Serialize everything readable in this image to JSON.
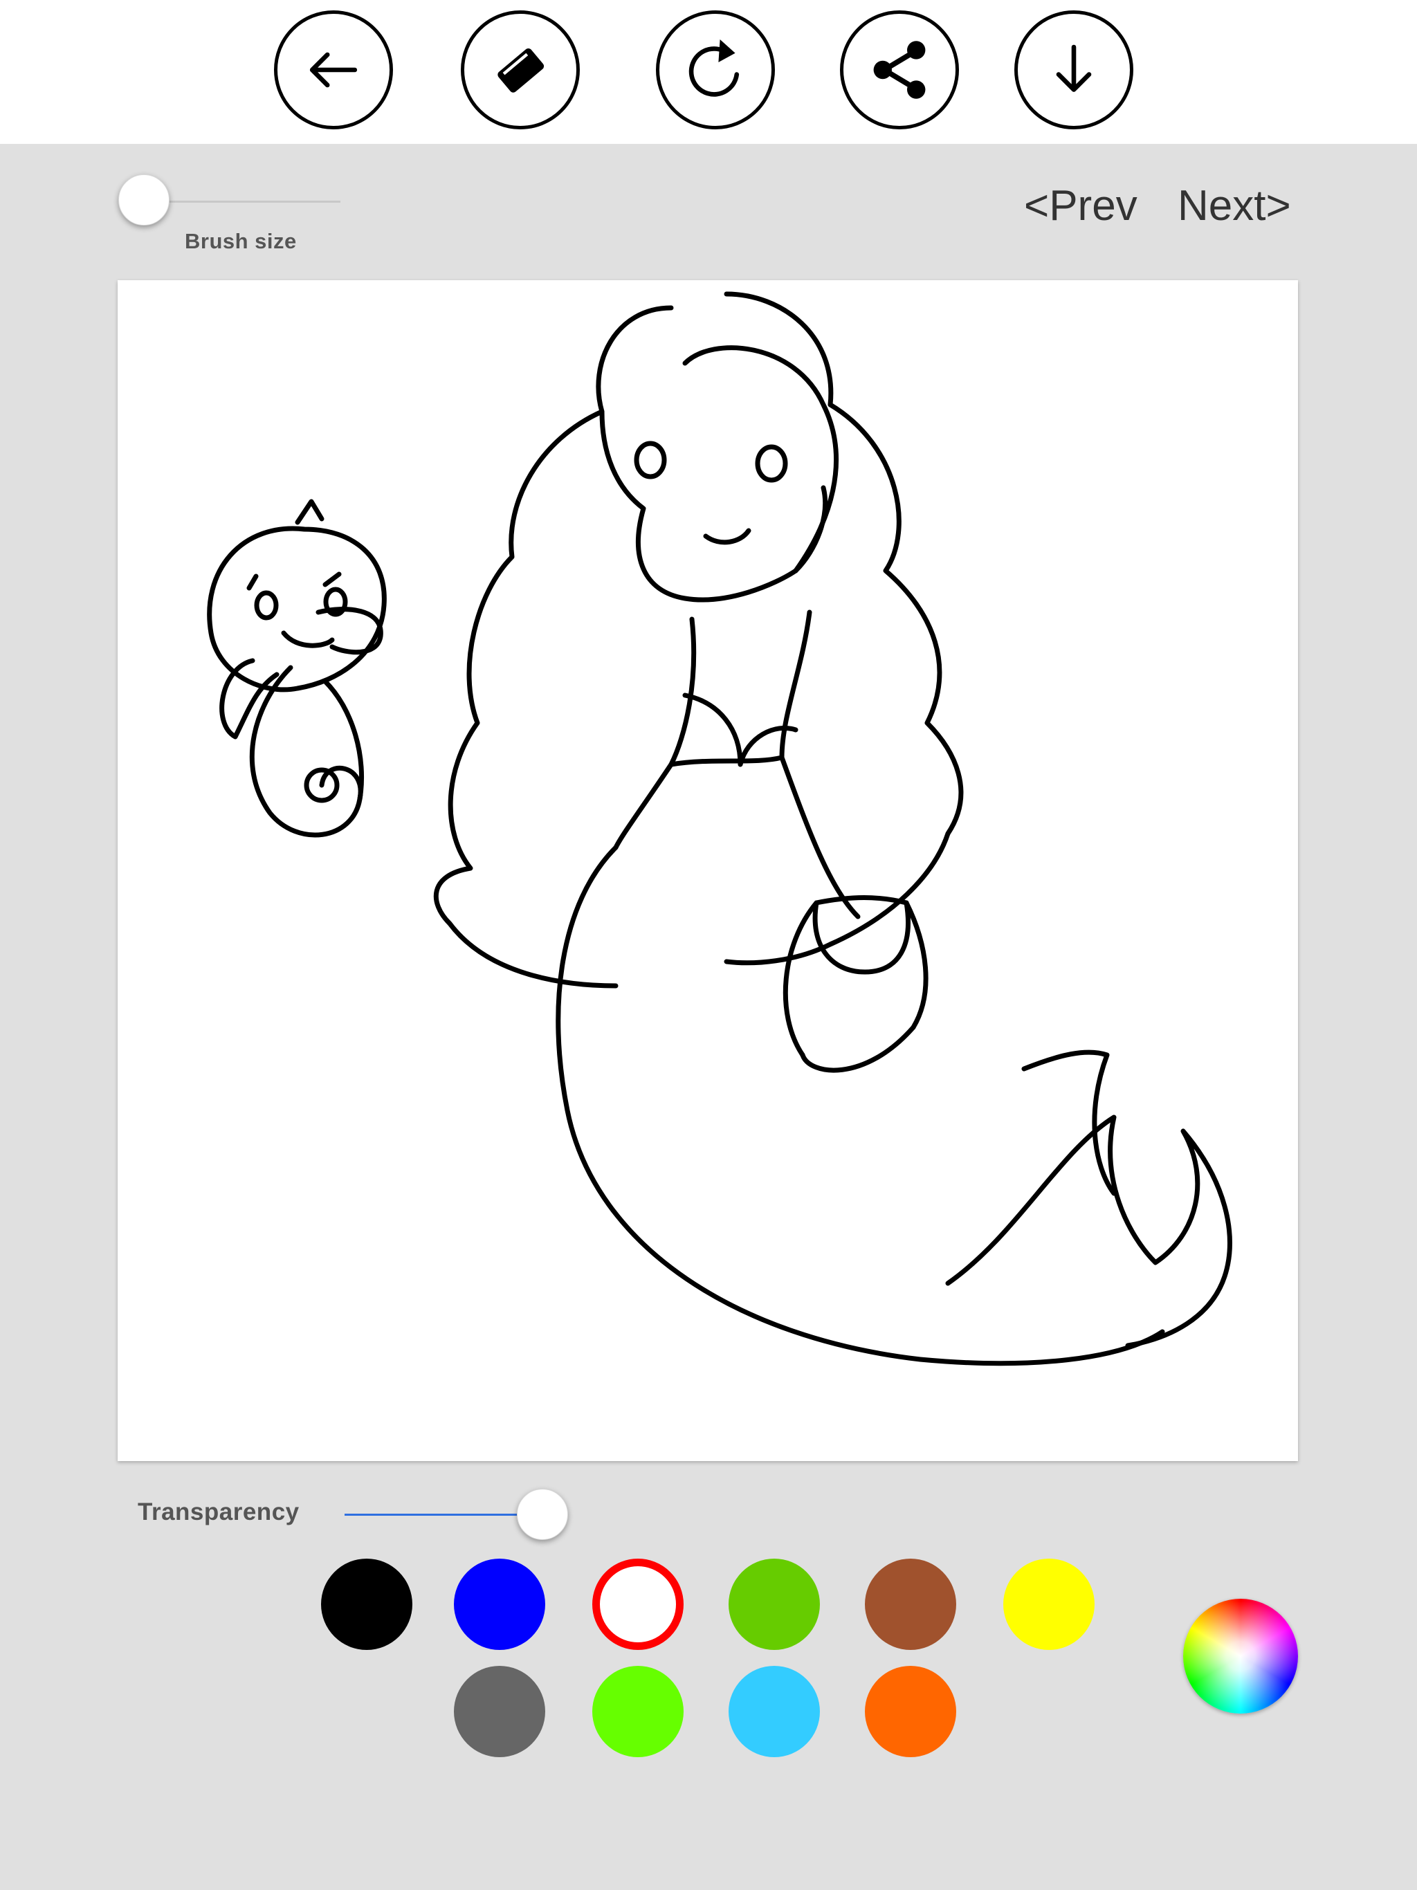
{
  "toolbar": {
    "buttons": [
      {
        "name": "back-button",
        "icon": "arrow-left-icon"
      },
      {
        "name": "eraser-button",
        "icon": "eraser-icon"
      },
      {
        "name": "redo-button",
        "icon": "redo-icon"
      },
      {
        "name": "share-button",
        "icon": "share-icon"
      },
      {
        "name": "download-button",
        "icon": "download-icon"
      }
    ]
  },
  "brush": {
    "label": "Brush size",
    "value": 0.0
  },
  "nav": {
    "prev_label": "<Prev",
    "next_label": "Next>"
  },
  "canvas": {
    "subject": "mermaid-and-seahorse-coloring-page"
  },
  "transparency": {
    "label": "Transparency",
    "value": 0.58
  },
  "palette": {
    "colors": [
      "#000000",
      "#0000ff",
      "#ffffff",
      "#66cc00",
      "#a0522d",
      "#ffff00",
      "#666666",
      "#66ff00",
      "#33ccff",
      "#ff6600"
    ],
    "selected_index": 2,
    "selected_ring_color": "#ff0000"
  },
  "colors": {
    "page_bg": "#e0e0e0",
    "accent_slider": "#2f6fe0"
  }
}
